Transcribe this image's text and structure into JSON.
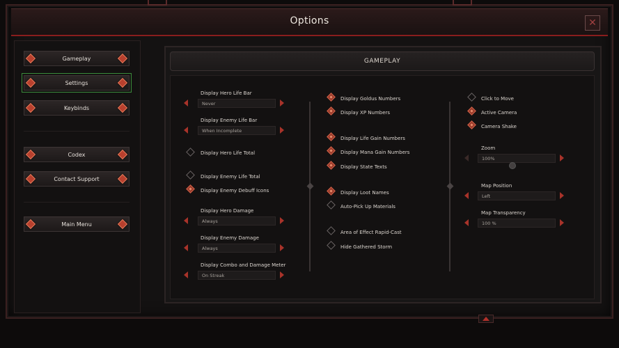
{
  "window": {
    "title": "Options"
  },
  "menu": {
    "items": [
      {
        "id": "gameplay",
        "label": "Gameplay"
      },
      {
        "id": "settings",
        "label": "Settings"
      },
      {
        "id": "keybinds",
        "label": "Keybinds"
      },
      {
        "id": "codex",
        "label": "Codex"
      },
      {
        "id": "contact",
        "label": "Contact Support"
      },
      {
        "id": "mainmenu",
        "label": "Main Menu"
      }
    ]
  },
  "section": {
    "title": "GAMEPLAY"
  },
  "col1": {
    "hero_life_bar": {
      "label": "Display Hero Life Bar",
      "value": "Never"
    },
    "enemy_life_bar": {
      "label": "Display Enemy Life Bar",
      "value": "When Incomplete"
    },
    "hero_life_total": {
      "label": "Display Hero Life Total",
      "checked": false
    },
    "enemy_life_total": {
      "label": "Display Enemy Life Total",
      "checked": false
    },
    "enemy_debuff": {
      "label": "Display Enemy Debuff Icons",
      "checked": true
    },
    "hero_damage": {
      "label": "Display Hero Damage",
      "value": "Always"
    },
    "enemy_damage": {
      "label": "Display Enemy Damage",
      "value": "Always"
    },
    "combo_meter": {
      "label": "Display Combo and Damage Meter",
      "value": "On Streak"
    }
  },
  "col2": {
    "goldus": {
      "label": "Display Goldus Numbers",
      "checked": true
    },
    "xp": {
      "label": "Display XP Numbers",
      "checked": true
    },
    "life_gain": {
      "label": "Display Life Gain Numbers",
      "checked": true
    },
    "mana_gain": {
      "label": "Display Mana Gain Numbers",
      "checked": true
    },
    "state_texts": {
      "label": "Display State Texts",
      "checked": true
    },
    "loot_names": {
      "label": "Display Loot Names",
      "checked": true
    },
    "auto_pickup": {
      "label": "Auto-Pick Up Materials",
      "checked": false
    },
    "aoe_rapid": {
      "label": "Area of Effect Rapid-Cast",
      "checked": false
    },
    "hide_storm": {
      "label": "Hide Gathered Storm",
      "checked": false
    }
  },
  "col3": {
    "click_move": {
      "label": "Click to Move",
      "checked": false
    },
    "active_camera": {
      "label": "Active Camera",
      "checked": true
    },
    "camera_shake": {
      "label": "Camera Shake",
      "checked": true
    },
    "zoom": {
      "label": "Zoom",
      "value": "100%"
    },
    "map_position": {
      "label": "Map Position",
      "value": "Left"
    },
    "map_transparency": {
      "label": "Map Transparency",
      "value": "100 %"
    }
  },
  "colors": {
    "accent": "#a8332a",
    "frame": "#8a1d1d",
    "highlight": "#3b8b3b"
  }
}
